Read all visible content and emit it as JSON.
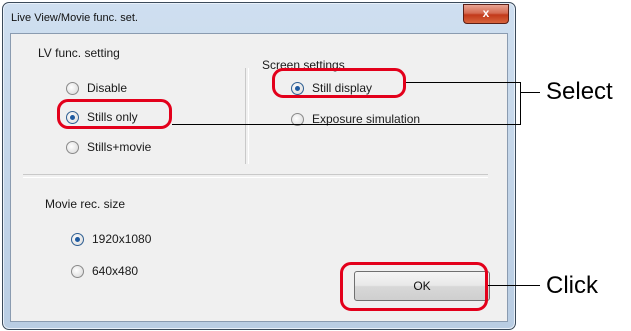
{
  "window": {
    "title": "Live View/Movie func. set.",
    "close_glyph": "x"
  },
  "lv_func": {
    "heading": "LV func. setting",
    "options": [
      {
        "label": "Disable",
        "checked": false
      },
      {
        "label": "Stills only",
        "checked": true
      },
      {
        "label": "Stills+movie",
        "checked": false
      }
    ]
  },
  "screen": {
    "heading": "Screen settings",
    "options": [
      {
        "label": "Still display",
        "checked": true
      },
      {
        "label": "Exposure simulation",
        "checked": false
      }
    ]
  },
  "movie": {
    "heading": "Movie rec. size",
    "options": [
      {
        "label": "1920x1080",
        "checked": true
      },
      {
        "label": "640x480",
        "checked": false
      }
    ]
  },
  "ok_label": "OK",
  "callouts": {
    "select": "Select",
    "click": "Click"
  },
  "colors": {
    "highlight": "#e3001b",
    "close_button": "#c2391a"
  }
}
